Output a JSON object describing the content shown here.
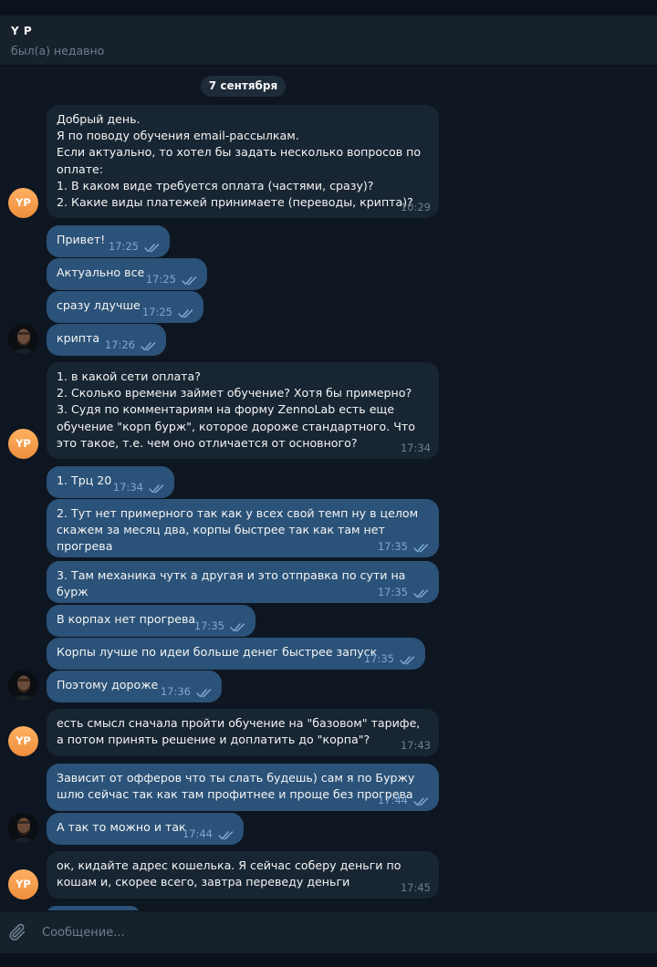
{
  "header": {
    "name": "Y P",
    "status": "был(а) недавно"
  },
  "date_pill": "7 сентября",
  "contact_avatar_initials": "YP",
  "messages": [
    {
      "dir": "in",
      "time": "10:29",
      "text": "Добрый день.\nЯ по поводу обучения email-рассылкам.\nЕсли актуально, то хотел бы задать несколько вопросов по оплате:\n1. В каком виде требуется оплата (частями, сразу)?\n2. Какие виды платежей принимаете (переводы, крипта)?"
    },
    {
      "dir": "out",
      "time": "17:25",
      "text": "Привет!"
    },
    {
      "dir": "out",
      "time": "17:25",
      "text": "Актуально все"
    },
    {
      "dir": "out",
      "time": "17:25",
      "text": "сразу лдучше"
    },
    {
      "dir": "out",
      "time": "17:26",
      "text": "крипта"
    },
    {
      "dir": "in",
      "time": "17:34",
      "text": "1. в какой сети оплата?\n2. Сколько времени займет обучение? Хотя бы примерно?\n3. Судя по комментариям на форму ZennoLab есть еще обучение \"корп бурж\", которое дороже стандартного. Что это такое, т.е. чем оно отличается от основного?"
    },
    {
      "dir": "out",
      "time": "17:34",
      "text": "1. Трц 20"
    },
    {
      "dir": "out",
      "time": "17:35",
      "text": "2. Тут нет примерного так как у всех свой темп ну в целом скажем за месяц два, корпы быстрее так как там нет прогрева"
    },
    {
      "dir": "out",
      "time": "17:35",
      "text": "3. Там механика чутк а другая и это отправка по сути на бурж"
    },
    {
      "dir": "out",
      "time": "17:35",
      "text": "В корпах нет прогрева"
    },
    {
      "dir": "out",
      "time": "17:35",
      "text": "Корпы лучше по идеи больше денег быстрее запуск"
    },
    {
      "dir": "out",
      "time": "17:36",
      "text": "Поэтому дороже"
    },
    {
      "dir": "in",
      "time": "17:43",
      "text": "есть смысл сначала пройти обучение на \"базовом\" тарифе, а потом принять решение и доплатить до \"корпа\"?"
    },
    {
      "dir": "out",
      "time": "17:44",
      "text": "Зависит от офферов что ты слать будешь) сам я по Буржу шлю сейчас так как там профитнее и проще без прогрева"
    },
    {
      "dir": "out",
      "time": "17:44",
      "text": "А так то можно и так"
    },
    {
      "dir": "in",
      "time": "17:45",
      "text": "ок, кидайте адрес кошелька. Я сейчас соберу деньги по кошам и, скорее всего, завтра переведу деньги"
    }
  ],
  "composer": {
    "placeholder": "Сообщение..."
  },
  "icons": {
    "attach": "paperclip-icon",
    "read": "double-check-icon"
  },
  "colors": {
    "background": "#0e1621",
    "incoming_bubble": "#182533",
    "outgoing_bubble": "#2b5278",
    "avatar": "#f0a050"
  }
}
